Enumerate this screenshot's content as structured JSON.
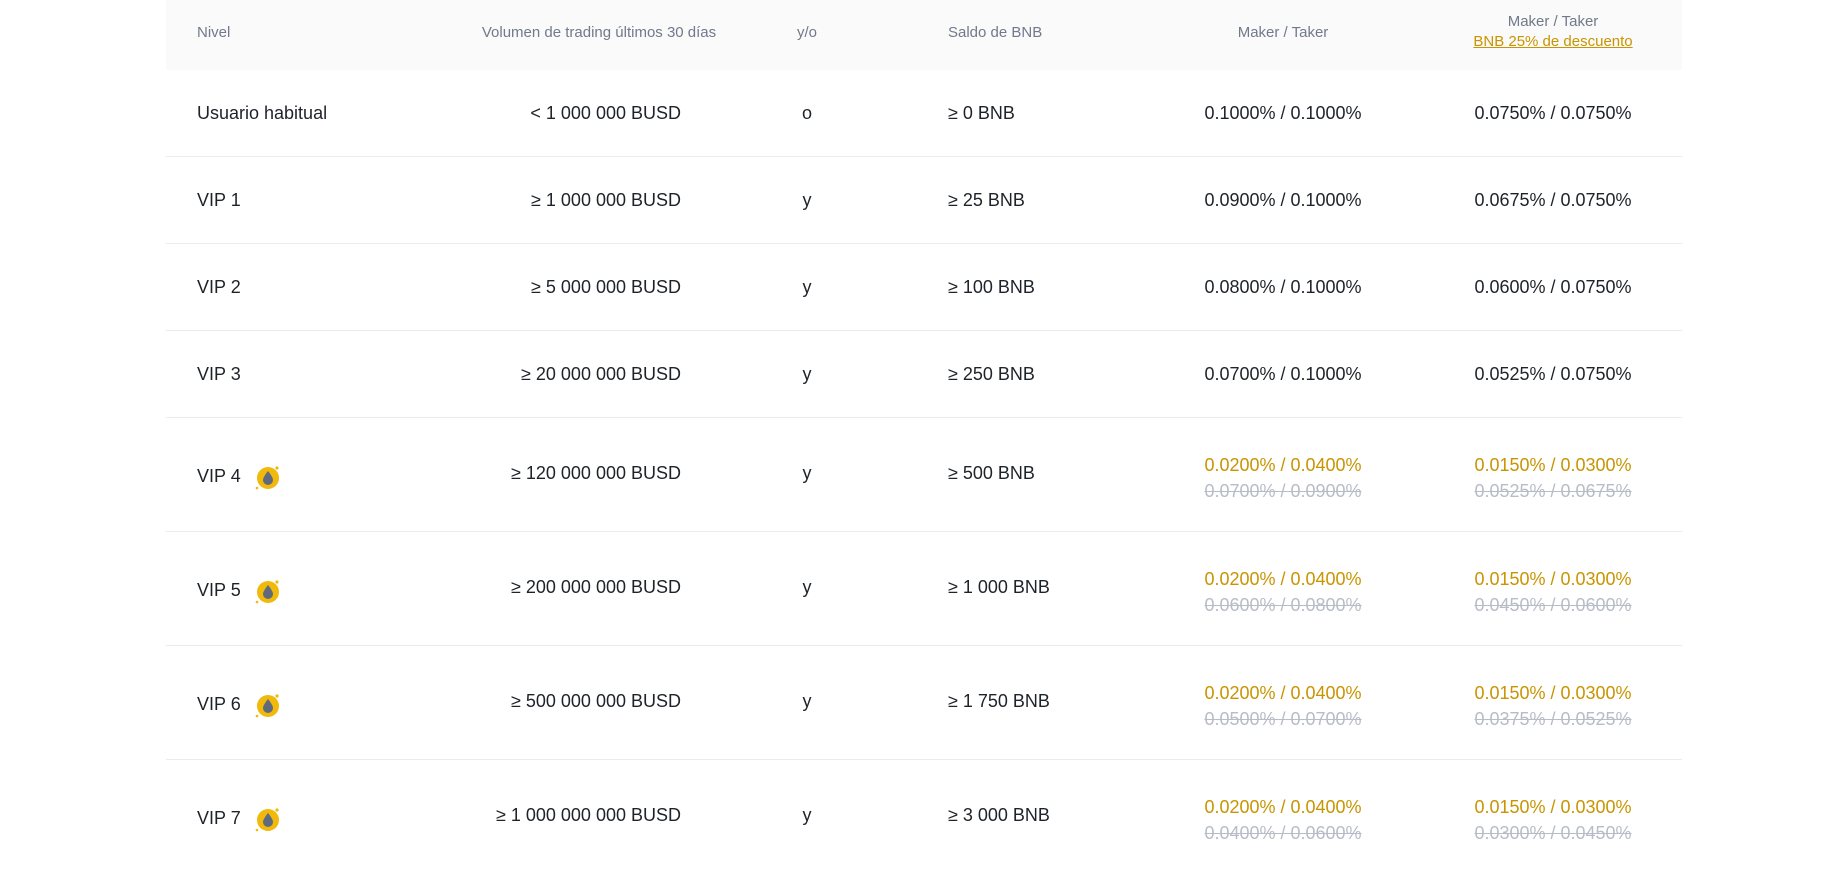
{
  "header": {
    "level": "Nivel",
    "volume": "Volumen de trading últimos 30 días",
    "andor": "y/o",
    "bnb_balance": "Saldo de BNB",
    "maker_taker": "Maker / Taker",
    "maker_taker_discount": "Maker / Taker",
    "discount_link": "BNB 25% de descuento"
  },
  "rows": [
    {
      "level": "Usuario habitual",
      "volume": "< 1 000 000 BUSD",
      "andor": "o",
      "bnb": "≥ 0 BNB",
      "mt": "0.1000% / 0.1000%",
      "mtd": "0.0750% / 0.0750%"
    },
    {
      "level": "VIP 1",
      "volume": "≥ 1 000 000 BUSD",
      "andor": "y",
      "bnb": "≥ 25 BNB",
      "mt": "0.0900% / 0.1000%",
      "mtd": "0.0675% / 0.0750%"
    },
    {
      "level": "VIP 2",
      "volume": "≥ 5 000 000 BUSD",
      "andor": "y",
      "bnb": "≥ 100 BNB",
      "mt": "0.0800% / 0.1000%",
      "mtd": "0.0600% / 0.0750%"
    },
    {
      "level": "VIP 3",
      "volume": "≥ 20 000 000 BUSD",
      "andor": "y",
      "bnb": "≥ 250 BNB",
      "mt": "0.0700% / 0.1000%",
      "mtd": "0.0525% / 0.0750%"
    },
    {
      "level": "VIP 4",
      "volume": "≥ 120 000 000 BUSD",
      "andor": "y",
      "bnb": "≥ 500 BNB",
      "mt": "0.0200% / 0.0400%",
      "mt_old": "0.0700% / 0.0900%",
      "mtd": "0.0150% / 0.0300%",
      "mtd_old": "0.0525% / 0.0675%",
      "icon": "liquidity-drop-icon"
    },
    {
      "level": "VIP 5",
      "volume": "≥ 200 000 000 BUSD",
      "andor": "y",
      "bnb": "≥ 1 000 BNB",
      "mt": "0.0200% / 0.0400%",
      "mt_old": "0.0600% / 0.0800%",
      "mtd": "0.0150% / 0.0300%",
      "mtd_old": "0.0450% / 0.0600%",
      "icon": "liquidity-drop-icon"
    },
    {
      "level": "VIP 6",
      "volume": "≥ 500 000 000 BUSD",
      "andor": "y",
      "bnb": "≥ 1 750 BNB",
      "mt": "0.0200% / 0.0400%",
      "mt_old": "0.0500% / 0.0700%",
      "mtd": "0.0150% / 0.0300%",
      "mtd_old": "0.0375% / 0.0525%",
      "icon": "liquidity-drop-icon"
    },
    {
      "level": "VIP 7",
      "volume": "≥ 1 000 000 000 BUSD",
      "andor": "y",
      "bnb": "≥ 3 000 BNB",
      "mt": "0.0200% / 0.0400%",
      "mt_old": "0.0400% / 0.0600%",
      "mtd": "0.0150% / 0.0300%",
      "mtd_old": "0.0300% / 0.0450%",
      "icon": "liquidity-drop-icon"
    }
  ],
  "colors": {
    "accent": "#c99400",
    "icon_yellow": "#f0b90b",
    "icon_drop": "#5f6b7c",
    "text": "#1e2329",
    "muted": "#707a8a",
    "strike": "#b7bdc6"
  }
}
